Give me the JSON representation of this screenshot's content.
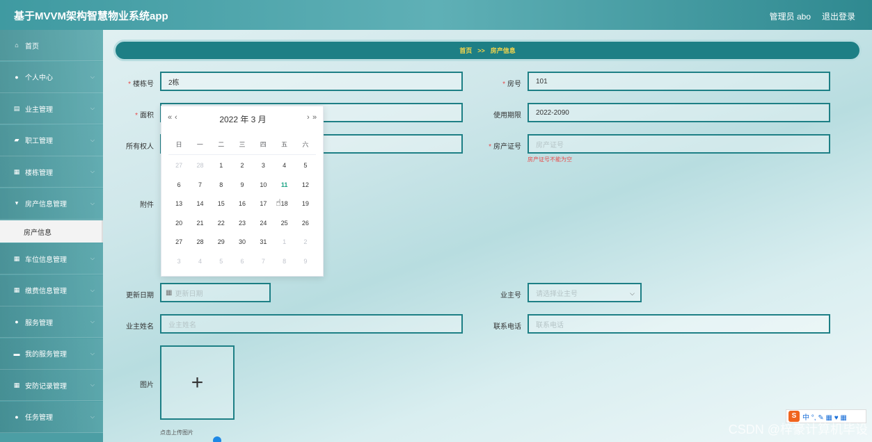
{
  "header": {
    "title": "基于MVVM架构智慧物业系统app",
    "user": "管理员 abo",
    "logout": "退出登录"
  },
  "sidebar": {
    "items": [
      {
        "label": "首页",
        "icon": "home-icon",
        "glyph": "⌂"
      },
      {
        "label": "个人中心",
        "icon": "user-icon",
        "glyph": "●"
      },
      {
        "label": "业主管理",
        "icon": "clipboard-icon",
        "glyph": "▤"
      },
      {
        "label": "职工管理",
        "icon": "thumbs-up-icon",
        "glyph": "▰"
      },
      {
        "label": "楼栋管理",
        "icon": "grid-icon",
        "glyph": "▦"
      },
      {
        "label": "房产信息管理",
        "icon": "pin-icon",
        "glyph": "▾"
      },
      {
        "label": "车位信息管理",
        "icon": "grid-icon",
        "glyph": "▦"
      },
      {
        "label": "缴费信息管理",
        "icon": "grid-icon",
        "glyph": "▦"
      },
      {
        "label": "服务管理",
        "icon": "user-icon",
        "glyph": "●"
      },
      {
        "label": "我的服务管理",
        "icon": "card-icon",
        "glyph": "▬"
      },
      {
        "label": "安防记录管理",
        "icon": "grid-icon",
        "glyph": "▦"
      },
      {
        "label": "任务管理",
        "icon": "user-icon",
        "glyph": "●"
      }
    ],
    "active_sub": "房产信息"
  },
  "breadcrumb": {
    "home": "首页",
    "sep": ">>",
    "current": "房产信息"
  },
  "form": {
    "building": {
      "label": "楼栋号",
      "value": "2栋"
    },
    "room": {
      "label": "房号",
      "value": "101"
    },
    "area": {
      "label": "面积"
    },
    "term": {
      "label": "使用期限",
      "value": "2022-2090"
    },
    "owner": {
      "label": "所有权人"
    },
    "cert": {
      "label": "房产证号",
      "placeholder": "房产证号",
      "error": "房产证号不能为空"
    },
    "attachment": {
      "label": "附件"
    },
    "update_date": {
      "label": "更新日期",
      "placeholder": "更新日期"
    },
    "owner_no": {
      "label": "业主号",
      "placeholder": "请选择业主号"
    },
    "owner_name": {
      "label": "业主姓名",
      "placeholder": "业主姓名"
    },
    "phone": {
      "label": "联系电话",
      "placeholder": "联系电话"
    },
    "image": {
      "label": "图片",
      "tip": "点击上传图片"
    }
  },
  "datepicker": {
    "title": "2022 年  3 月",
    "prev_year": "«",
    "prev_month": "‹",
    "next_month": "›",
    "next_year": "»",
    "weekdays": [
      "日",
      "一",
      "二",
      "三",
      "四",
      "五",
      "六"
    ],
    "today": "11",
    "days": [
      [
        "27",
        "28",
        "1",
        "2",
        "3",
        "4",
        "5"
      ],
      [
        "6",
        "7",
        "8",
        "9",
        "10",
        "11",
        "12"
      ],
      [
        "13",
        "14",
        "15",
        "16",
        "17",
        "18",
        "19"
      ],
      [
        "20",
        "21",
        "22",
        "23",
        "24",
        "25",
        "26"
      ],
      [
        "27",
        "28",
        "29",
        "30",
        "31",
        "1",
        "2"
      ],
      [
        "3",
        "4",
        "5",
        "6",
        "7",
        "8",
        "9"
      ]
    ]
  },
  "watermark": "CSDN @梓豪计算机毕设",
  "ime": {
    "logo": "S",
    "text": "中 °, ✎ ▦ ♥ ▦"
  }
}
